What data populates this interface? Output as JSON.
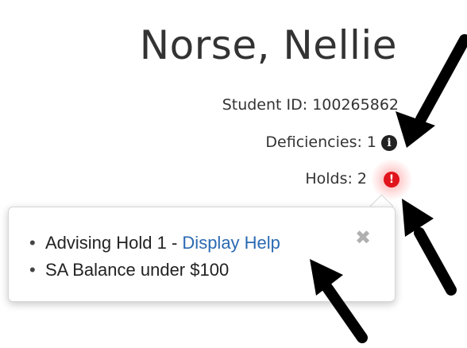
{
  "student": {
    "name": "Norse, Nellie",
    "id_text": "Student ID: 100265862",
    "deficiencies_text": "Deficiencies: 1",
    "holds_text": "Holds: 2"
  },
  "icons": {
    "info": "info-circle-icon",
    "alert": "exclamation-circle-icon",
    "close": "close-icon"
  },
  "popover": {
    "items": [
      {
        "text": "Advising Hold 1 - ",
        "link_text": "Display Help"
      },
      {
        "text": "SA Balance under $100"
      }
    ],
    "close_label": "✖"
  },
  "colors": {
    "alert": "#e0141c",
    "link": "#2a6ab2",
    "close": "#b0b0b0"
  }
}
